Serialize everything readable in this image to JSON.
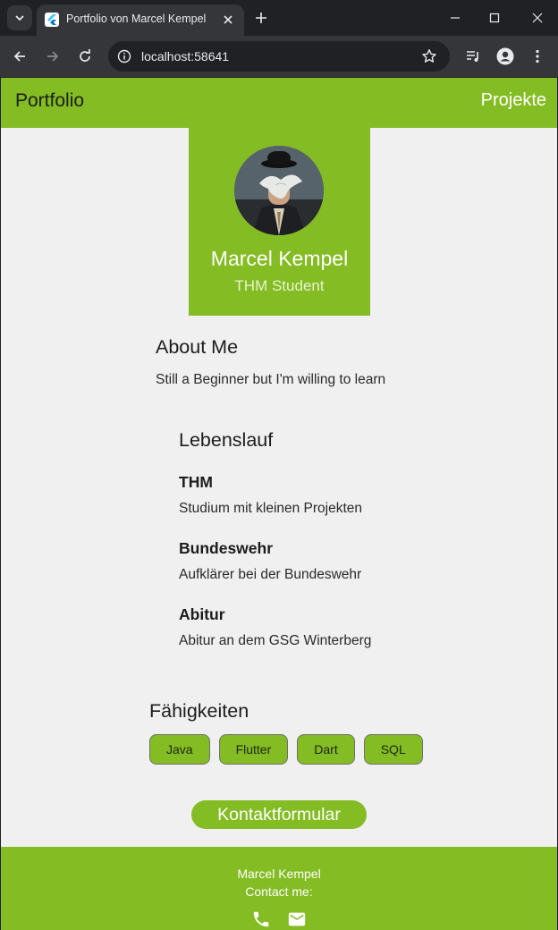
{
  "browser": {
    "tab_title": "Portfolio von Marcel Kempel",
    "url": "localhost:58641"
  },
  "appbar": {
    "title": "Portfolio",
    "action": "Projekte"
  },
  "profile": {
    "name": "Marcel Kempel",
    "subtitle": "THM Student"
  },
  "about": {
    "title": "About Me",
    "text": "Still a Beginner but I'm willing to learn"
  },
  "cv": {
    "title": "Lebenslauf",
    "items": [
      {
        "title": "THM",
        "desc": "Studium mit kleinen Projekten"
      },
      {
        "title": "Bundeswehr",
        "desc": "Aufklärer bei der Bundeswehr"
      },
      {
        "title": "Abitur",
        "desc": "Abitur an dem GSG Winterberg"
      }
    ]
  },
  "skills": {
    "title": "Fähigkeiten",
    "items": [
      "Java",
      "Flutter",
      "Dart",
      "SQL"
    ]
  },
  "contact_button": "Kontaktformular",
  "footer": {
    "name": "Marcel Kempel",
    "contact": "Contact me:",
    "icons": [
      "phone-icon",
      "mail-icon"
    ]
  },
  "colors": {
    "accent": "#84bc23",
    "page_background": "#f0f0f0",
    "browser_dark": "#202124"
  }
}
